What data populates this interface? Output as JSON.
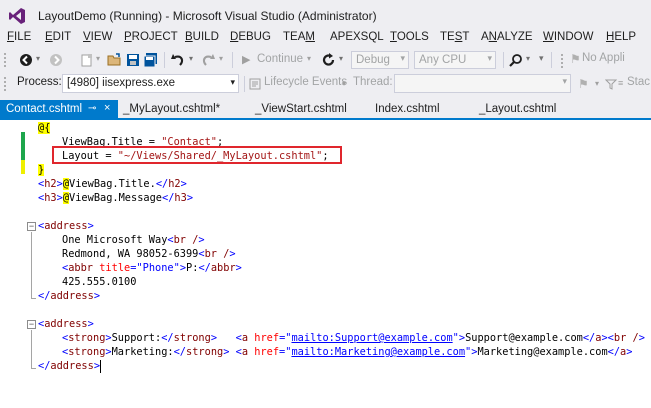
{
  "window": {
    "title": "LayoutDemo (Running) - Microsoft Visual Studio (Administrator)"
  },
  "menu": [
    {
      "label": "FILE",
      "ul": "F",
      "rest": "ILE"
    },
    {
      "label": "EDIT",
      "ul": "E",
      "rest": "DIT"
    },
    {
      "label": "VIEW",
      "ul": "V",
      "rest": "IEW"
    },
    {
      "label": "PROJECT",
      "ul": "P",
      "rest": "ROJECT"
    },
    {
      "label": "BUILD",
      "ul": "B",
      "rest": "UILD"
    },
    {
      "label": "DEBUG",
      "ul": "D",
      "rest": "EBUG"
    },
    {
      "label": "TEAM",
      "pre": "TEA",
      "ul": "M",
      "rest": ""
    },
    {
      "label": "APEXSQL",
      "ul": "",
      "rest": "APEXSQL"
    },
    {
      "label": "TOOLS",
      "ul": "T",
      "rest": "OOLS"
    },
    {
      "label": "TEST",
      "pre": "TE",
      "ul": "S",
      "rest": "T"
    },
    {
      "label": "ANALYZE",
      "pre": "A",
      "ul": "N",
      "rest": "ALYZE"
    },
    {
      "label": "WINDOW",
      "ul": "W",
      "rest": "INDOW"
    },
    {
      "label": "HELP",
      "ul": "H",
      "rest": "ELP"
    }
  ],
  "toolbar": {
    "continue_label": "Continue",
    "config_value": "Debug",
    "platform_value": "Any CPU",
    "overflow_label": "No Appli"
  },
  "processbar": {
    "process_label": "Process:",
    "process_value": "[4980] iisexpress.exe",
    "lifecycle_label": "Lifecycle Events",
    "thread_label": "Thread:",
    "stack_label": "Stac"
  },
  "tabs": [
    {
      "label": "Contact.cshtml",
      "active": true
    },
    {
      "label": "_MyLayout.cshtml*",
      "active": false
    },
    {
      "label": "_ViewStart.cshtml",
      "active": false
    },
    {
      "label": "Index.cshtml",
      "active": false
    },
    {
      "label": "_Layout.cshtml",
      "active": false
    }
  ],
  "code": {
    "line1": "@{",
    "line2_a": "ViewBag.Title = ",
    "line2_b": "\"Contact\"",
    "line2_c": ";",
    "line3_a": "Layout = ",
    "line3_b": "\"~/Views/Shared/_MyLayout.cshtml\"",
    "line3_c": ";",
    "line4": "}",
    "line5": [
      "<",
      "h2",
      ">",
      "@",
      "ViewBag.Title.",
      "</",
      "h2",
      ">"
    ],
    "line6": [
      "<",
      "h3",
      ">",
      "@",
      "ViewBag.Message",
      "</",
      "h3",
      ">"
    ],
    "address_open": "address",
    "addr_line1_text": "One Microsoft Way",
    "addr_line2_text": "Redmond, WA 98052-6399",
    "br": "br /",
    "abbr_tag": "abbr",
    "abbr_attr": "title",
    "abbr_val": "\"Phone\"",
    "abbr_text": "P:",
    "phone": "425.555.0100",
    "strong_tag": "strong",
    "support_label": "Support:",
    "a_tag": "a",
    "href_attr": "href",
    "support_href": "mailto:Support@example.com",
    "support_text": "Support@example.com",
    "marketing_label": "Marketing:",
    "marketing_href": "mailto:Marketing@example.com",
    "marketing_text": "Marketing@example.com"
  },
  "colors": {
    "accent": "#007acc",
    "highlight_box": "#e0262d",
    "change_margin": "#1ea64c"
  }
}
